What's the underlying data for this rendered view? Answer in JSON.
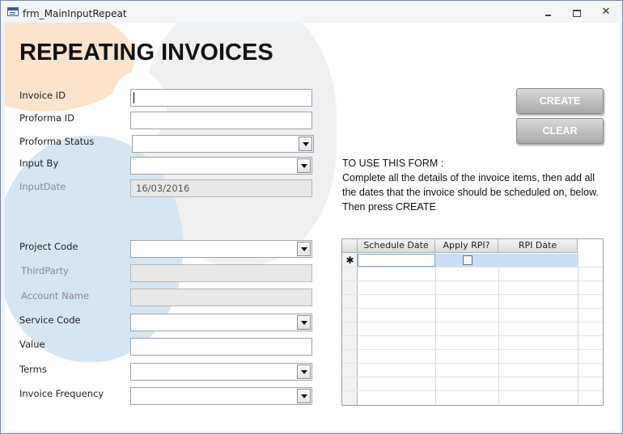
{
  "window": {
    "title": "frm_MainInputRepeat"
  },
  "form": {
    "heading": "REPEATING INVOICES",
    "fields": {
      "invoice_id": {
        "label": "Invoice ID",
        "value": ""
      },
      "proforma_id": {
        "label": "Proforma ID",
        "value": ""
      },
      "proforma_status": {
        "label": "Proforma Status",
        "value": ""
      },
      "input_by": {
        "label": "Input By",
        "value": ""
      },
      "input_date": {
        "label": "InputDate",
        "value": "16/03/2016"
      },
      "project_code": {
        "label": "Project Code",
        "value": ""
      },
      "third_party": {
        "label": "ThirdParty",
        "value": ""
      },
      "account_name": {
        "label": "Account Name",
        "value": ""
      },
      "service_code": {
        "label": "Service Code",
        "value": ""
      },
      "value": {
        "label": "Value",
        "value": ""
      },
      "terms": {
        "label": "Terms",
        "value": ""
      },
      "invoice_frequency": {
        "label": "Invoice Frequency",
        "value": ""
      }
    },
    "buttons": {
      "create": "CREATE",
      "clear": "CLEAR"
    },
    "instructions": {
      "heading": "TO USE THIS FORM :",
      "line1": "Complete all the details of the invoice items, then add all the dates that the invoice should be scheduled on, below.",
      "line2": "Then press CREATE"
    },
    "schedule_grid": {
      "columns": [
        "Schedule Date",
        "Apply RPI?",
        "RPI Date"
      ],
      "new_row_marker": "✱"
    }
  },
  "colors": {
    "accent_orange": "#fbe3cc",
    "accent_blue": "#d6e5f2",
    "button_gray": "#b8b8b8",
    "selected_cell": "#c9ddf6"
  }
}
